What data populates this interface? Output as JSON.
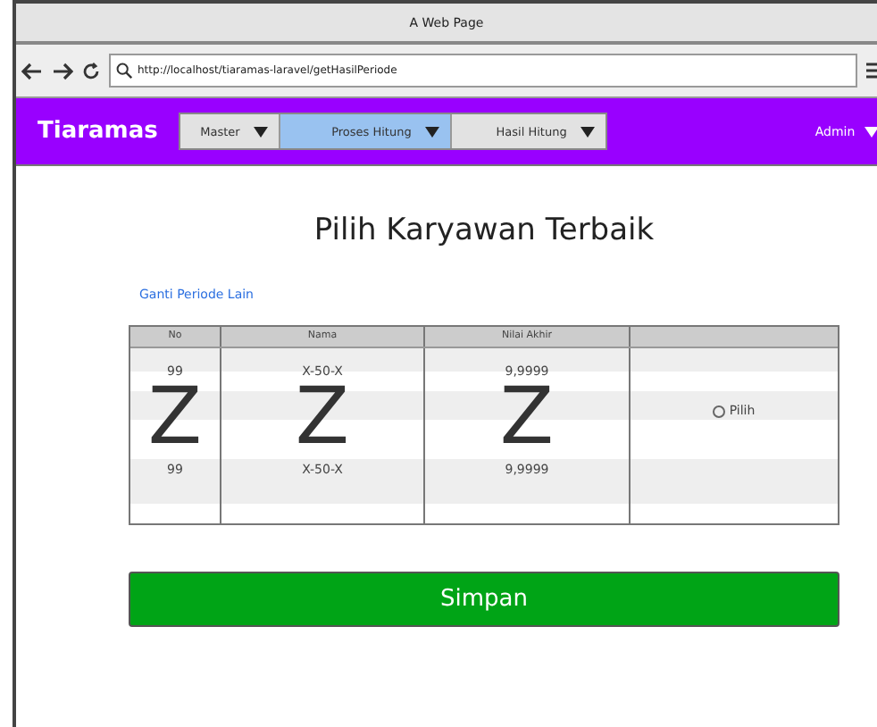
{
  "window": {
    "title": "A Web Page"
  },
  "address_bar": {
    "url": "http://localhost/tiaramas-laravel/getHasilPeriode"
  },
  "navbar": {
    "brand": "Tiaramas",
    "menus": [
      {
        "label": "Master",
        "selected": false
      },
      {
        "label": "Proses Hitung",
        "selected": true
      },
      {
        "label": "Hasil Hitung",
        "selected": false
      }
    ],
    "user_menu": "Admin"
  },
  "page": {
    "title": "Pilih Karyawan Terbaik",
    "link": "Ganti Periode Lain"
  },
  "table": {
    "columns": [
      "No",
      "Nama",
      "Nilai Akhir"
    ],
    "first_row": [
      "99",
      "X-50-X",
      "9,9999"
    ],
    "repeat_marks": [
      "Z",
      "Z",
      "Z"
    ],
    "last_row": [
      "99",
      "X-50-X",
      "9,9999"
    ],
    "choice": {
      "label": "Pilih",
      "selected": false
    }
  },
  "save_button": "Simpan"
}
